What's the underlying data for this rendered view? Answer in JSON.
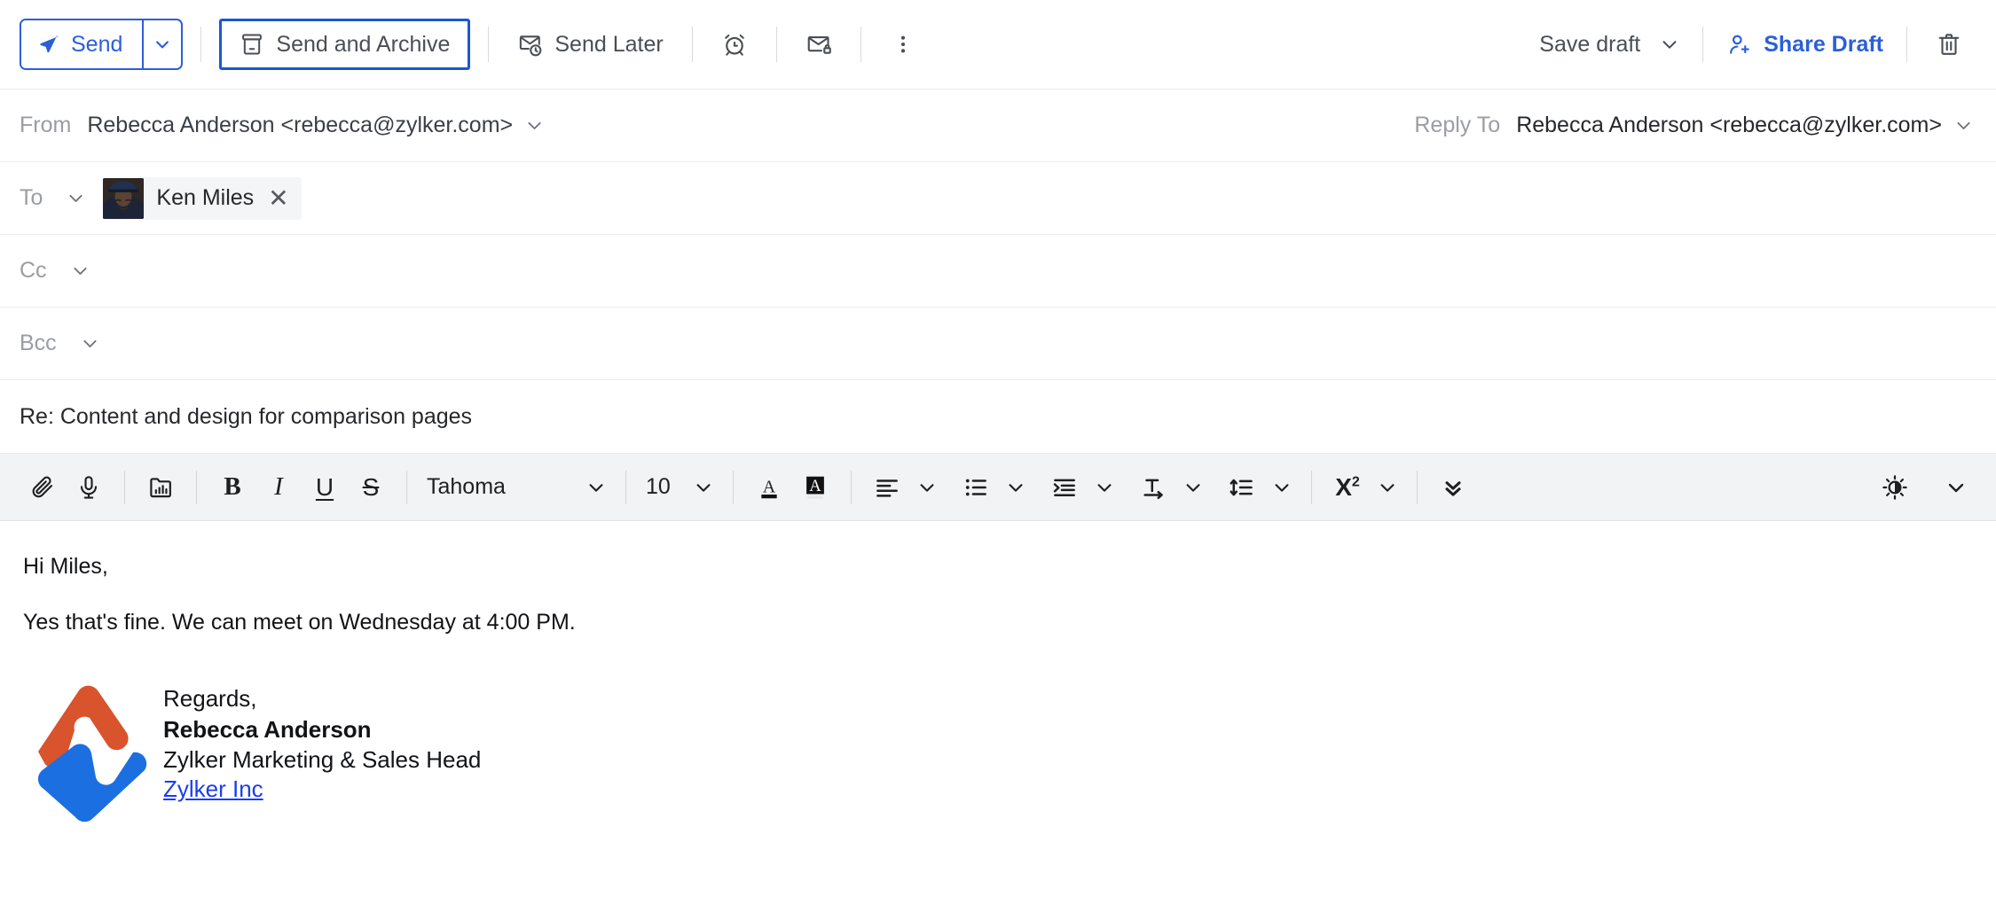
{
  "action_bar": {
    "send_label": "Send",
    "send_icon": "paper-plane-icon",
    "send_dropdown_icon": "chevron-down-icon",
    "send_and_archive_label": "Send and Archive",
    "send_and_archive_icon": "archive-box-icon",
    "send_later_label": "Send Later",
    "send_later_icon": "clock-send-icon",
    "reminder_icon": "alarm-clock-icon",
    "secure_icon": "envelope-lock-icon",
    "more_icon": "three-dots-vertical-icon",
    "save_draft_label": "Save draft",
    "save_draft_caret_icon": "chevron-down-icon",
    "share_draft_label": "Share Draft",
    "share_draft_icon": "person-plus-icon",
    "delete_icon": "trash-icon",
    "accent_blue": "#2b5fd9",
    "focus_border": "#1a56d6"
  },
  "header": {
    "from_label": "From",
    "from_value": "Rebecca Anderson <rebecca@zylker.com>",
    "reply_to_label": "Reply To",
    "reply_to_value": "Rebecca Anderson <rebecca@zylker.com>",
    "to_label": "To",
    "to_recipient": "Ken Miles",
    "remove_recipient_icon": "close-icon",
    "cc_label": "Cc",
    "bcc_label": "Bcc",
    "subject_value": "Re: Content and design for comparison pages"
  },
  "format_toolbar": {
    "attach_icon": "paperclip-icon",
    "voice_icon": "microphone-icon",
    "insert_image_icon": "insert-image-icon",
    "bold_label": "B",
    "italic_label": "I",
    "underline_label": "U",
    "strikethrough_label": "S",
    "font_family": "Tahoma",
    "font_size": "10",
    "font_color_icon": "font-color-icon",
    "highlight_icon": "text-highlight-icon",
    "align_icon": "align-left-icon",
    "list_icon": "bulleted-list-icon",
    "indent_icon": "indent-icon",
    "text_direction_icon": "text-direction-icon",
    "line_spacing_icon": "line-spacing-icon",
    "superscript_label": "X",
    "superscript_exponent": "2",
    "more_options_icon": "double-chevron-down-icon",
    "theme_icon": "brightness-icon",
    "theme_caret_icon": "chevron-down-icon",
    "caret_icon": "chevron-down-icon",
    "bar_background": "#f1f3f4"
  },
  "message": {
    "greeting": "Hi Miles,",
    "paragraph": "Yes that's fine. We can meet on Wednesday at 4:00 PM.",
    "signature": {
      "logo_icon": "zylker-logo-icon",
      "logo_orange": "#d9532c",
      "logo_blue": "#1b6fe0",
      "closing": "Regards,",
      "name": "Rebecca Anderson",
      "title": "Zylker Marketing & Sales Head",
      "company_link": "Zylker Inc",
      "link_color": "#1a3df0"
    }
  }
}
